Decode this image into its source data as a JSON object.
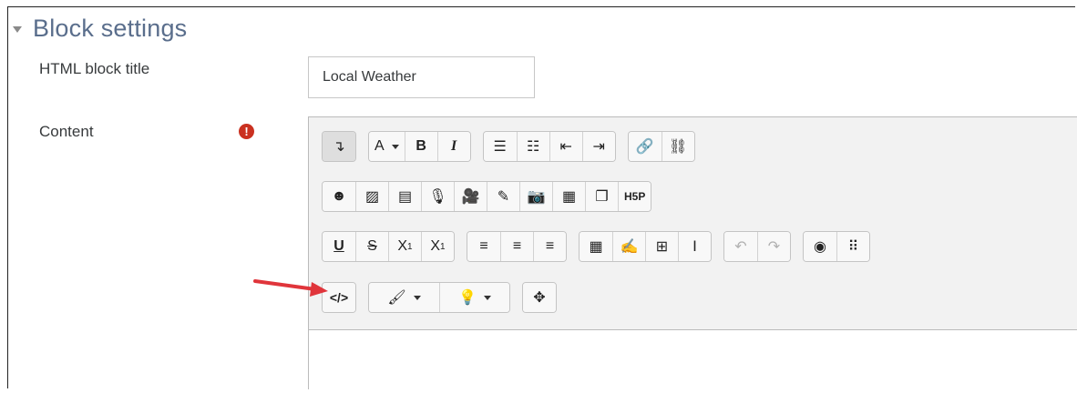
{
  "section": {
    "title": "Block settings"
  },
  "fields": {
    "title_label": "HTML block title",
    "title_value": "Local Weather",
    "content_label": "Content",
    "required_mark": "!"
  },
  "toolbar": {
    "row1": [
      [
        {
          "name": "show-more-buttons",
          "icon": "↴",
          "active": true
        }
      ],
      [
        {
          "name": "font-color",
          "icon": "A",
          "dropdown": true
        },
        {
          "name": "bold",
          "icon": "B"
        },
        {
          "name": "italic",
          "icon": "I"
        }
      ],
      [
        {
          "name": "unordered-list",
          "icon": "☰"
        },
        {
          "name": "ordered-list",
          "icon": "☷"
        },
        {
          "name": "outdent",
          "icon": "⇤"
        },
        {
          "name": "indent",
          "icon": "⇥"
        }
      ],
      [
        {
          "name": "link",
          "icon": "🔗"
        },
        {
          "name": "unlink",
          "icon": "⛓"
        }
      ]
    ],
    "row2": [
      [
        {
          "name": "emoji",
          "icon": "☻"
        },
        {
          "name": "image",
          "icon": "▨"
        },
        {
          "name": "media",
          "icon": "▤"
        },
        {
          "name": "record-audio",
          "icon": "🎙"
        },
        {
          "name": "record-video",
          "icon": "🎥"
        },
        {
          "name": "drawing",
          "icon": "✎"
        },
        {
          "name": "snapshot",
          "icon": "📷"
        },
        {
          "name": "word-import",
          "icon": "▦"
        },
        {
          "name": "copy",
          "icon": "❐"
        },
        {
          "name": "h5p",
          "icon": "H5P"
        }
      ]
    ],
    "row3": [
      [
        {
          "name": "underline",
          "icon": "U"
        },
        {
          "name": "strikethrough",
          "icon": "S"
        },
        {
          "name": "subscript",
          "icon": "X",
          "sub": "1"
        },
        {
          "name": "superscript",
          "icon": "X",
          "sup": "1"
        }
      ],
      [
        {
          "name": "align-left",
          "icon": "≡"
        },
        {
          "name": "align-center",
          "icon": "≡"
        },
        {
          "name": "align-right",
          "icon": "≡"
        }
      ],
      [
        {
          "name": "equation",
          "icon": "▦"
        },
        {
          "name": "edit",
          "icon": "✍"
        },
        {
          "name": "table",
          "icon": "⊞"
        },
        {
          "name": "clear-formatting",
          "icon": "Ⅰ"
        }
      ],
      [
        {
          "name": "undo",
          "icon": "↶",
          "disabled": true
        },
        {
          "name": "redo",
          "icon": "↷",
          "disabled": true
        }
      ],
      [
        {
          "name": "accessibility-checker",
          "icon": "◉"
        },
        {
          "name": "screenreader-helper",
          "icon": "⠿"
        }
      ]
    ],
    "row4": [
      [
        {
          "name": "html-source",
          "icon": "</>"
        }
      ],
      [
        {
          "name": "paint",
          "icon": "🖌",
          "dropdown": true,
          "wide": true
        },
        {
          "name": "tip",
          "icon": "💡",
          "dropdown": true,
          "wide": true
        }
      ],
      [
        {
          "name": "fullscreen",
          "icon": "✥"
        }
      ]
    ]
  },
  "colors": {
    "annotation_arrow": "#e0353b",
    "section_title": "#5a6e8c",
    "required": "#ca3120"
  }
}
